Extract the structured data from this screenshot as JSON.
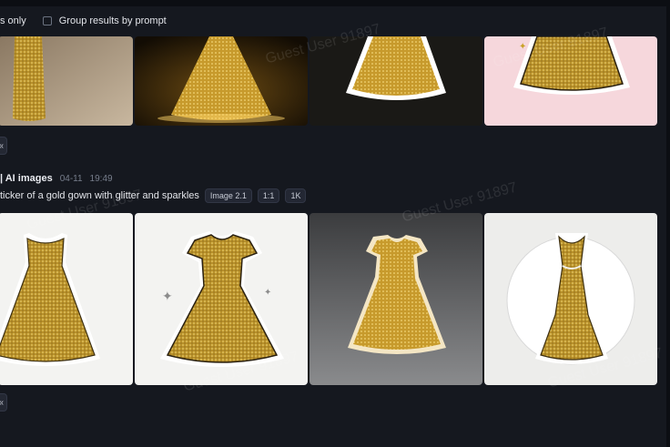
{
  "filters": {
    "partial_only_label": "s only",
    "group_results_label": "Group results by prompt"
  },
  "group": {
    "source_label": "| AI images",
    "date": "04-11",
    "time": "19:49",
    "prompt": "ticker of a gold gown with glitter and sparkles",
    "tags": [
      "Image 2.1",
      "1:1",
      "1K"
    ]
  },
  "watermark_text": "Guest User 91897",
  "buttons": {
    "more_label_1": "«",
    "more_label_2": "«"
  },
  "theme": {
    "background": "#15181f",
    "gold": "#c9a227",
    "accent_pink": "#f6d7dc"
  }
}
